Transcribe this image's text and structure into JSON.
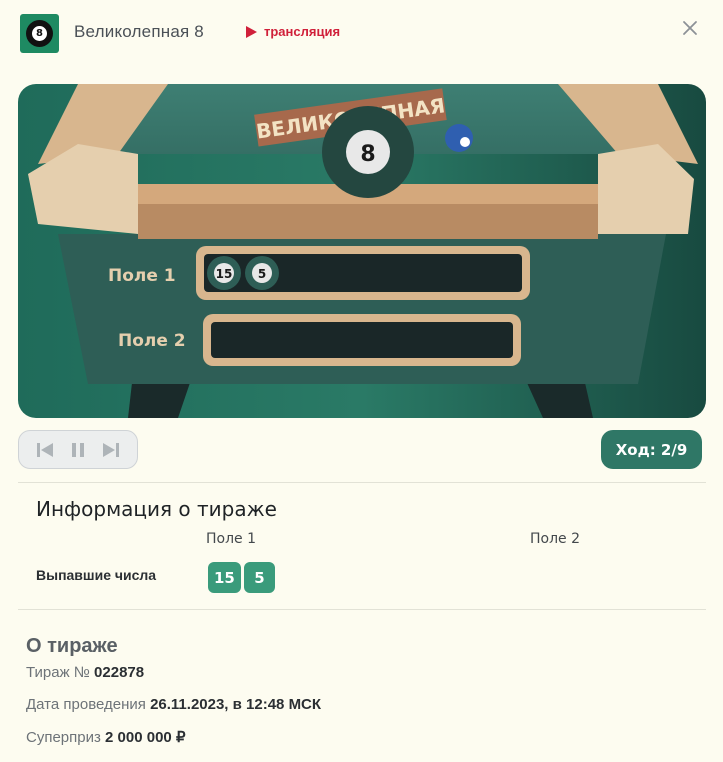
{
  "header": {
    "title": "Великолепная 8",
    "live_label": "трансляция",
    "logo_number": "8",
    "icons": {
      "logo": "pool-ball-8-icon",
      "live": "play-icon",
      "close": "close-icon"
    }
  },
  "stage": {
    "banner_text": "ВЕЛИКОЛЕПНАЯ",
    "logo_number": "8",
    "fields": [
      {
        "label": "Поле 1",
        "balls": [
          "15",
          "5"
        ]
      },
      {
        "label": "Поле 2",
        "balls": []
      }
    ]
  },
  "player": {
    "icons": [
      "skip-back-icon",
      "pause-icon",
      "skip-forward-icon"
    ],
    "move_label": "Ход: 2/9"
  },
  "draw_info": {
    "title": "Информация о тираже",
    "field_headers": [
      "Поле 1",
      "Поле 2"
    ],
    "row_label": "Выпавшие числа",
    "field1_numbers": [
      "15",
      "5"
    ],
    "field2_numbers": []
  },
  "about": {
    "title": "О тираже",
    "draw_label": "Тираж №",
    "draw_number": "022878",
    "date_label": "Дата проведения",
    "date_value": "26.11.2023, в 12:48 МСК",
    "prize_label": "Суперприз",
    "prize_value": "2 000 000 ₽"
  },
  "colors": {
    "accent": "#2f7766",
    "number_badge": "#3a9b7b",
    "live": "#d0203a",
    "background": "#fdfcf0"
  }
}
